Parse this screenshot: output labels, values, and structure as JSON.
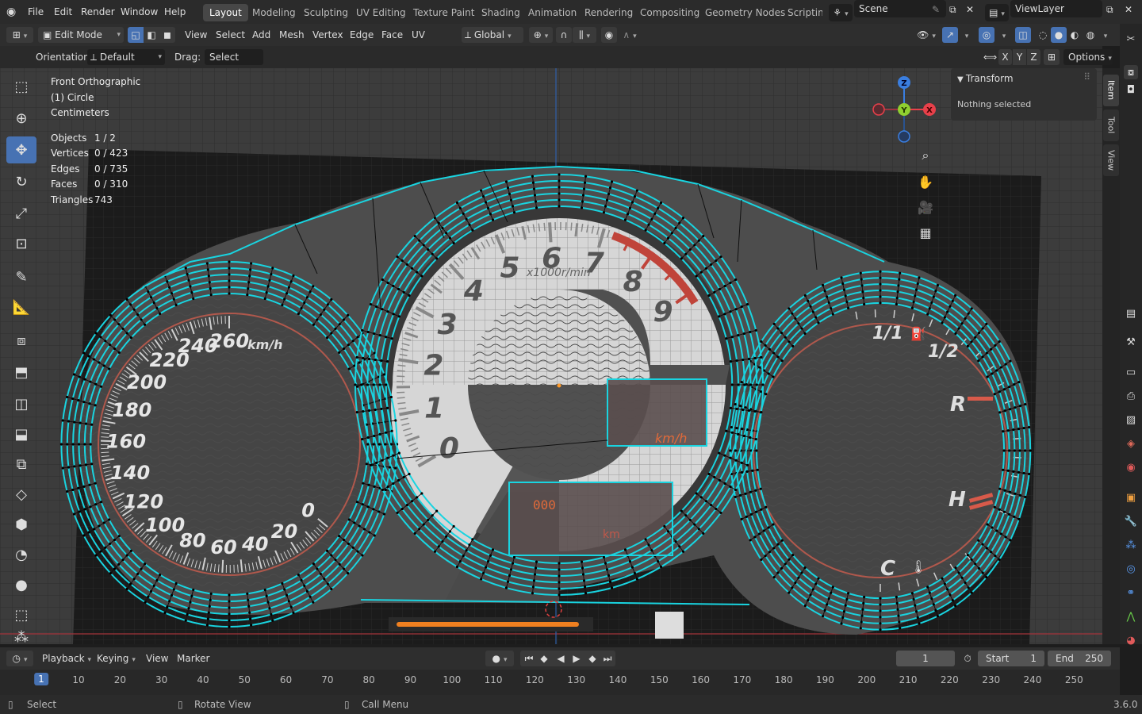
{
  "menu": {
    "items": [
      "File",
      "Edit",
      "Render",
      "Window",
      "Help"
    ],
    "workspaces": [
      "Layout",
      "Modeling",
      "Sculpting",
      "UV Editing",
      "Texture Paint",
      "Shading",
      "Animation",
      "Rendering",
      "Compositing",
      "Geometry Nodes",
      "Scripting"
    ],
    "active_workspace": "Layout",
    "scene_label": "Scene",
    "view_layer_label": "ViewLayer"
  },
  "header": {
    "mode": "Edit Mode",
    "menus": [
      "View",
      "Select",
      "Add",
      "Mesh",
      "Vertex",
      "Edge",
      "Face",
      "UV"
    ],
    "transform_orientation": "Global",
    "orientation_label": "Orientation:",
    "orientation_value": "Default",
    "drag_label": "Drag:",
    "drag_value": "Select Box",
    "axes": [
      "X",
      "Y",
      "Z"
    ],
    "options_label": "Options"
  },
  "viewport": {
    "view_name": "Front Orthographic",
    "object_name": "(1) Circle",
    "units": "Centimeters",
    "stats": [
      {
        "label": "Objects",
        "value": "1 / 2"
      },
      {
        "label": "Vertices",
        "value": "0 / 423"
      },
      {
        "label": "Edges",
        "value": "0 / 735"
      },
      {
        "label": "Faces",
        "value": "0 / 310"
      },
      {
        "label": "Triangles",
        "value": "743"
      }
    ],
    "gizmo_axes": {
      "x": "X",
      "y": "Y",
      "z": "Z"
    },
    "colors": {
      "mesh_edge": "#19d4e0",
      "x_axis": "#e8404a",
      "y_axis": "#8fcf30",
      "z_axis": "#3a7ee0",
      "background": "#3b3b3b",
      "panel_bg": "#1a1a1a"
    }
  },
  "gauges": {
    "speedometer": {
      "labels": [
        "0",
        "20",
        "40",
        "60",
        "80",
        "100",
        "120",
        "140",
        "160",
        "180",
        "200",
        "220",
        "240",
        "260"
      ],
      "unit": "km/h"
    },
    "tachometer": {
      "labels": [
        "0",
        "1",
        "2",
        "3",
        "4",
        "5",
        "6",
        "7",
        "8",
        "9"
      ],
      "unit": "x1000r/min",
      "digital_unit": "km/h",
      "odometer": "000",
      "odo_unit": "km"
    },
    "fuel_temp": {
      "labels": [
        "1/1",
        "1/2",
        "R",
        "H",
        "C"
      ]
    }
  },
  "npanel": {
    "section_title": "Transform",
    "message": "Nothing selected",
    "tabs": [
      "Item",
      "Tool",
      "View"
    ],
    "active_tab": "Item"
  },
  "timeline": {
    "menus": [
      "Playback",
      "Keying",
      "View",
      "Marker"
    ],
    "current_frame": "1",
    "start_label": "Start",
    "start_value": "1",
    "end_label": "End",
    "end_value": "250",
    "ticks": [
      "1",
      "10",
      "20",
      "30",
      "40",
      "50",
      "60",
      "70",
      "80",
      "90",
      "100",
      "110",
      "120",
      "130",
      "140",
      "150",
      "160",
      "170",
      "180",
      "190",
      "200",
      "210",
      "220",
      "230",
      "240",
      "250"
    ]
  },
  "status": {
    "select": "Select",
    "rotate": "Rotate View",
    "menu": "Call Menu",
    "version": "3.6.0"
  }
}
